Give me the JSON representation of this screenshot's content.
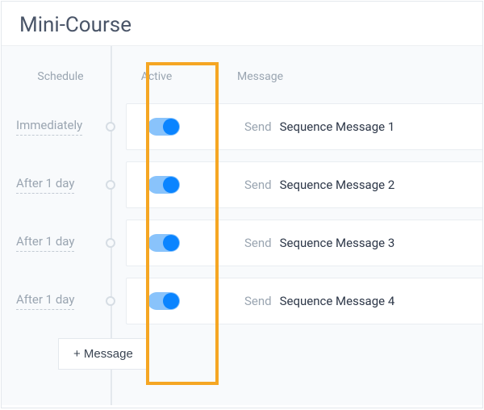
{
  "title": "Mini-Course",
  "headers": {
    "schedule": "Schedule",
    "active": "Active",
    "message": "Message"
  },
  "send_label": "Send",
  "add_button_label": "+ Message",
  "rows": [
    {
      "schedule": "Immediately",
      "active": true,
      "message": "Sequence Message 1"
    },
    {
      "schedule": "After 1 day",
      "active": true,
      "message": "Sequence Message 2"
    },
    {
      "schedule": "After 1 day",
      "active": true,
      "message": "Sequence Message 3"
    },
    {
      "schedule": "After 1 day",
      "active": true,
      "message": "Sequence Message 4"
    }
  ]
}
